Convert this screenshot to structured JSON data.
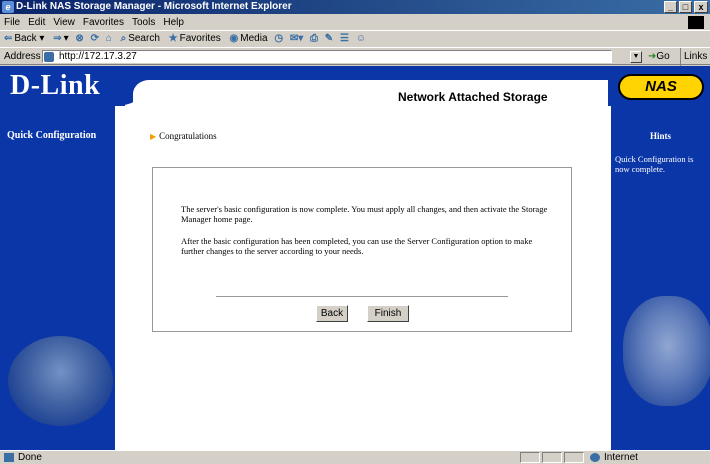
{
  "window": {
    "title": "D-Link NAS Storage Manager - Microsoft Internet Explorer",
    "minimize": "_",
    "maximize": "□",
    "close": "x"
  },
  "menu": [
    "File",
    "Edit",
    "View",
    "Favorites",
    "Tools",
    "Help"
  ],
  "toolbar": {
    "back": "Back",
    "search": "Search",
    "favorites": "Favorites",
    "media": "Media"
  },
  "address": {
    "label": "Address",
    "url": "http://172.17.3.27",
    "go": "Go",
    "links": "Links"
  },
  "header": {
    "logo": "D-Link",
    "subtitle": "Network Attached Storage",
    "badge": "NAS"
  },
  "sidebar": {
    "item": "Quick Configuration"
  },
  "content": {
    "breadcrumb": "Congratulations",
    "paragraph1": "The server's basic configuration is now complete. You must apply all changes, and then activate the Storage Manager home page.",
    "paragraph2": "After the basic configuration has been completed, you can use the Server Configuration option to make further changes to the server according to your needs.",
    "back_label": "Back",
    "finish_label": "Finish"
  },
  "hints": {
    "title": "Hints",
    "text": "Quick Configuration is now complete."
  },
  "status": {
    "text": "Done",
    "zone": "Internet"
  },
  "colors": {
    "brand_blue": "#0b36a8",
    "badge_yellow": "#ffd400",
    "title_bar": "#0a246a"
  }
}
